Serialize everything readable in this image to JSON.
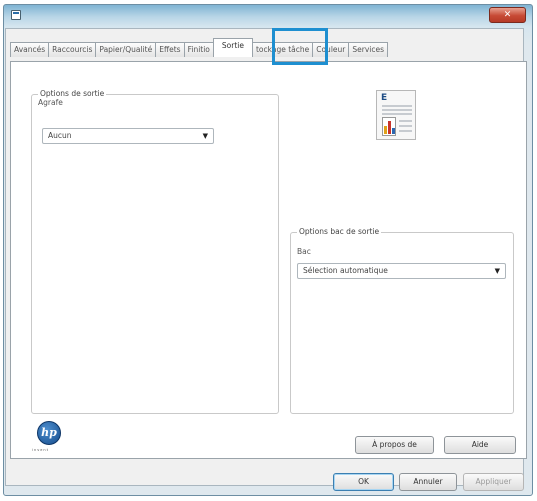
{
  "tabs": [
    {
      "label": "Avancés"
    },
    {
      "label": "Raccourcis"
    },
    {
      "label": "Papier/Qualité"
    },
    {
      "label": "Effets"
    },
    {
      "label": "Finitio"
    },
    {
      "label": "Sortie"
    },
    {
      "label": "tockage tâche"
    },
    {
      "label": "Couleur"
    },
    {
      "label": "Services"
    }
  ],
  "output_options": {
    "group_title": "Options de sortie",
    "stapler_label": "Agrafe",
    "stapler_value": "Aucun"
  },
  "output_bin": {
    "group_title": "Options bac de sortie",
    "bin_label": "Bac",
    "bin_value": "Sélection automatique"
  },
  "preview": {
    "letter": "E"
  },
  "buttons": {
    "about": "À propos de",
    "help": "Aide",
    "ok": "OK",
    "cancel": "Annuler",
    "apply": "Appliquer"
  },
  "window": {
    "close_glyph": "✕"
  },
  "brand": {
    "logo_text": "hp",
    "tagline": "invent"
  }
}
